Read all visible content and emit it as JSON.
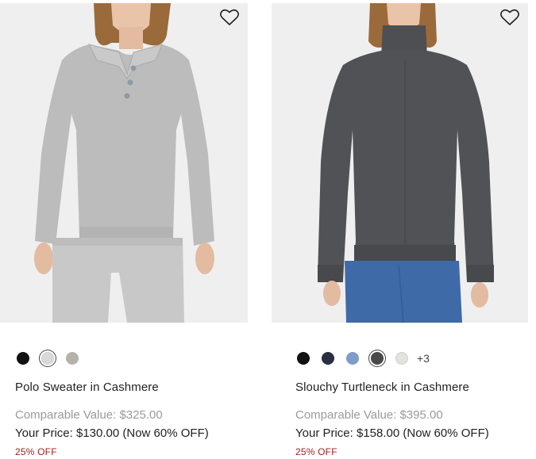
{
  "products": [
    {
      "name": "Polo Sweater in Cashmere",
      "comparable": "Comparable Value: $325.00",
      "price": "Your Price: $130.00 (Now 60% OFF)",
      "discount": "25% OFF",
      "swatches": [
        "#111111",
        "#d9d9d9",
        "#b7b1ab"
      ],
      "selected_swatch": 1,
      "more_colors": "",
      "image_icon": "grey-polo-sweater-photo"
    },
    {
      "name": "Slouchy Turtleneck in Cashmere",
      "comparable": "Comparable Value: $395.00",
      "price": "Your Price: $158.00 (Now 60% OFF)",
      "discount": "25% OFF",
      "swatches": [
        "#111111",
        "#2b2d40",
        "#7f9cc9",
        "#4a4a4a",
        "#e4e2dc"
      ],
      "selected_swatch": 3,
      "more_colors": "+3",
      "image_icon": "charcoal-turtleneck-photo"
    }
  ],
  "colors": {
    "discount": "#9b1c1c",
    "muted": "#9a9a9a",
    "image_bg": "#efefef"
  }
}
